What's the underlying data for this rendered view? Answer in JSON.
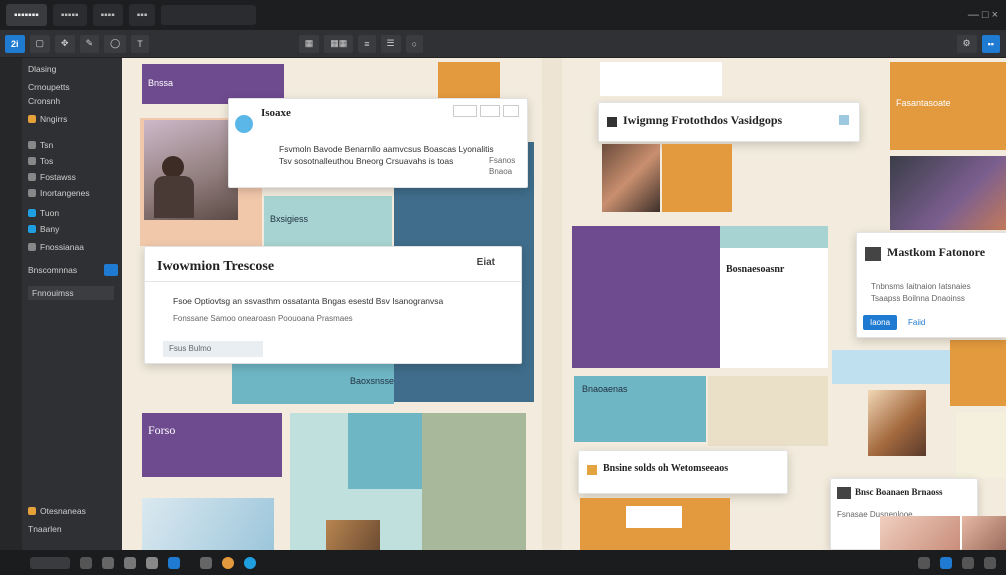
{
  "tabs": {
    "t1": "▪▪▪▪▪▪▪",
    "t2": "▪▪▪▪▪",
    "t3": "▪▪▪▪",
    "t4": "▪▪▪",
    "addr": "",
    "ctrl": "— □ ×"
  },
  "toolbar": {
    "app_badge": "2i",
    "share": "▪▪"
  },
  "sidebar": {
    "items": [
      {
        "label": "Dlasing"
      },
      {
        "label": "Crnoupetts"
      },
      {
        "label": "Cronsnh"
      },
      {
        "label": "Nngirrs"
      },
      {
        "label": "Tsn"
      },
      {
        "label": "Tos"
      },
      {
        "label": "Fostawss"
      },
      {
        "label": "Inortangenes"
      },
      {
        "label": "Tuon"
      },
      {
        "label": "Bany"
      },
      {
        "label": "Fnossianaa"
      },
      {
        "label": "Bnscomnnas"
      },
      {
        "label": "Fnnouimss"
      },
      {
        "label": "Otesnaneas"
      },
      {
        "label": "Tnaarlen"
      }
    ]
  },
  "canvas": {
    "block_top_left_label": "Bnssa",
    "block_bottom_left_label": "Forso",
    "teal_label": "Bxsigiess",
    "teal_mid_label": "Baoxsnsse",
    "card1": {
      "title": "Isoaxe",
      "text1": "Fsvmoln Bavode Benarnllo aamvcsus Boascas Lyonalitis",
      "text2": "Tsv sosotnalleuthou Bneorg Crsuavahs is toas",
      "text3": "Fsanos Bnaoa"
    },
    "card2": {
      "title": "Iwowmion Trescose",
      "badge": "Eiat",
      "text1": "Fsoe Optiovtsg an ssvasthm ossatanta Bngas esestd Bsv Isanogranvsa",
      "text2": "Fonssane Samoo onearoasn Poouoana Prasmaes",
      "footer": "Fsus  Bulmo"
    },
    "card3": {
      "title": "Iwigmng Frotothdos Vasidgops"
    },
    "card4": {
      "title": "Mastkom Fatonore",
      "text1": "Tnbnsms Iaitnaion Iatsnaies",
      "text2": "Tsaapss Boilnna Dnaoinss",
      "btn1": "Iaona",
      "btn2": "Faiid"
    },
    "card5": {
      "title": "Bnsine solds oh Wetomseeaos"
    },
    "card6": {
      "title": "Bnsc Boanaen Brnaoss",
      "text1": "Fsnasae Dusnenlooe"
    },
    "purple_card_label": "Bosnaesoasnr",
    "orange_label": "Fasantasoate",
    "teal_card_text": "Bnaoaenas"
  },
  "colors": {
    "purple": "#6e4a8f",
    "teal": "#6fb6c4",
    "blue_gray": "#3f6d8b",
    "orange": "#e39a3e",
    "mint": "#a7d4d2",
    "peach": "#f2c8ab",
    "accent": "#1f7bd1"
  }
}
